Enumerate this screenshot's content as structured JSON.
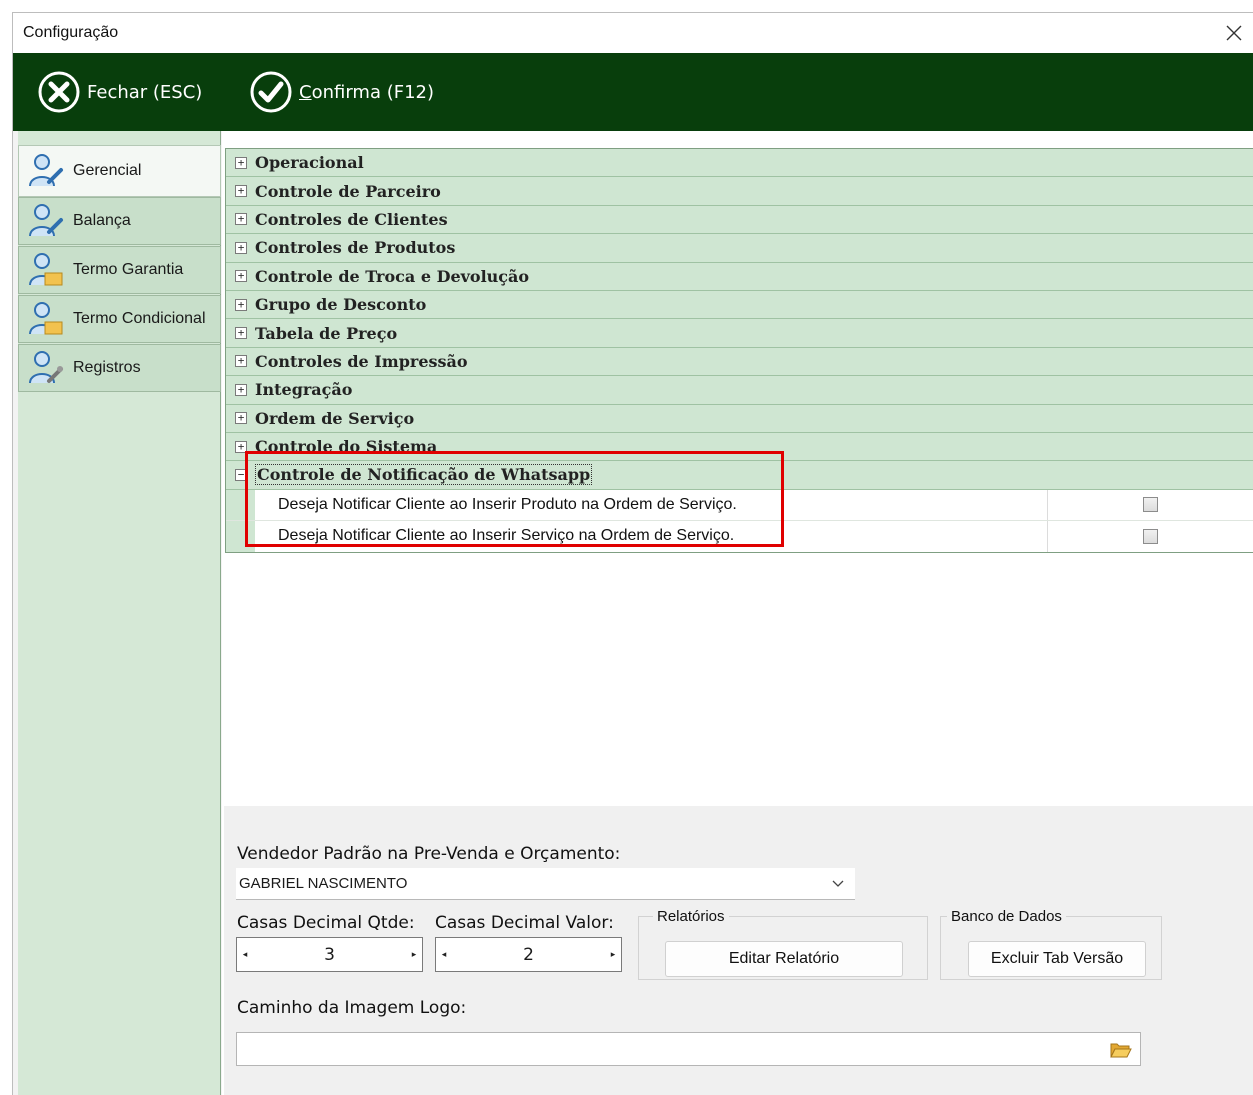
{
  "window": {
    "title": "Configuração"
  },
  "toolbar": {
    "close_label": "Fechar (ESC)",
    "confirm_label": "Confirma (F12)"
  },
  "sidebar": {
    "items": [
      {
        "label": "Gerencial",
        "active": true
      },
      {
        "label": "Balança",
        "active": false
      },
      {
        "label": "Termo Garantia",
        "active": false
      },
      {
        "label": "Termo Condicional",
        "active": false
      },
      {
        "label": "Registros",
        "active": false
      }
    ]
  },
  "tree": {
    "groups": [
      {
        "label": "Operacional",
        "expanded": false
      },
      {
        "label": "Controle de Parceiro",
        "expanded": false
      },
      {
        "label": "Controles de Clientes",
        "expanded": false
      },
      {
        "label": "Controles de Produtos",
        "expanded": false
      },
      {
        "label": "Controle de Troca e Devolução",
        "expanded": false
      },
      {
        "label": "Grupo de Desconto",
        "expanded": false
      },
      {
        "label": "Tabela de Preço",
        "expanded": false
      },
      {
        "label": "Controles de Impressão",
        "expanded": false
      },
      {
        "label": "Integração",
        "expanded": false
      },
      {
        "label": "Ordem de Serviço",
        "expanded": false
      },
      {
        "label": "Controle do Sistema",
        "expanded": false
      },
      {
        "label": "Controle de Notificação de Whatsapp",
        "expanded": true
      }
    ],
    "whatsapp_options": [
      {
        "label": "Deseja Notificar Cliente ao Inserir Produto na Ordem de Serviço.",
        "checked": false
      },
      {
        "label": "Deseja Notificar Cliente ao Inserir Serviço na Ordem de Serviço.",
        "checked": false
      }
    ],
    "plus_glyph": "+",
    "minus_glyph": "−"
  },
  "bottom": {
    "vendor_label": "Vendedor Padrão na Pre-Venda e Orçamento:",
    "vendor_value": "GABRIEL NASCIMENTO",
    "qty_label": "Casas Decimal Qtde:",
    "qty_value": "3",
    "value_label": "Casas Decimal Valor:",
    "value_value": "2",
    "reports_title": "Relatórios",
    "reports_button": "Editar Relatório",
    "db_title": "Banco de Dados",
    "db_button": "Excluir Tab Versão",
    "logo_label": "Caminho da Imagem Logo:",
    "logo_value": ""
  },
  "colors": {
    "toolbar_bg": "#083e0c",
    "sidebar_bg": "#d5e8d6",
    "group_row_bg": "#cfe6d2",
    "highlight": "#e00000"
  },
  "icons": {
    "close": "close-icon",
    "toolbar_close": "x-circle-icon",
    "toolbar_confirm": "check-circle-icon",
    "sidebar": "user-settings-icon",
    "dropdown": "chevron-down-icon",
    "spin_left": "arrow-left-icon",
    "spin_right": "arrow-right-icon",
    "folder": "folder-open-icon"
  }
}
